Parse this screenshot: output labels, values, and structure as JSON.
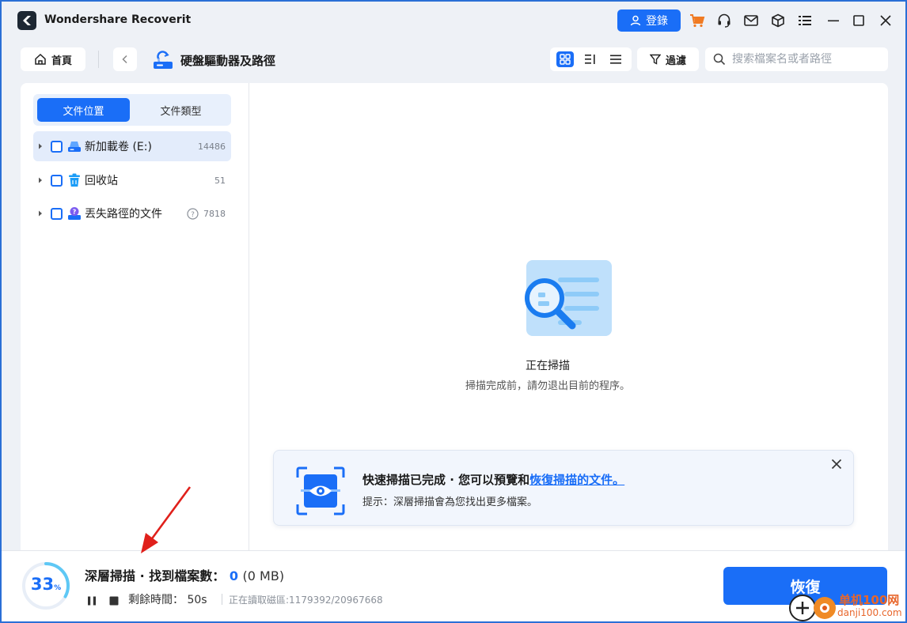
{
  "app": {
    "title": "Wondershare Recoverit",
    "login_label": "登錄"
  },
  "titlebar_icons": [
    "cart-icon",
    "headset-icon",
    "mail-icon",
    "cube-icon",
    "menu-icon",
    "minimize-icon",
    "maximize-icon",
    "close-icon"
  ],
  "toolbar": {
    "home_label": "首頁",
    "path_title": "硬盤驅動器及路徑",
    "filter_label": "過濾",
    "search_placeholder": "搜索檔案名或者路徑"
  },
  "sidebar": {
    "tabs": [
      {
        "label": "文件位置",
        "active": true
      },
      {
        "label": "文件類型",
        "active": false
      }
    ],
    "items": [
      {
        "label": "新加載卷 (E:)",
        "count": "14486",
        "icon": "drive-icon",
        "selected": true
      },
      {
        "label": "回收站",
        "count": "51",
        "icon": "recycle-bin-icon",
        "selected": false
      },
      {
        "label": "丟失路徑的文件",
        "count": "7818",
        "icon": "lost-path-icon",
        "selected": false
      }
    ]
  },
  "scan": {
    "title": "正在掃描",
    "subtitle": "掃描完成前，請勿退出目前的程序。"
  },
  "notice": {
    "title_prefix": "快速掃描已完成 · 您可以預覽和",
    "title_link": "恢復掃描的文件。",
    "hint": "提示：深層掃描會為您找出更多檔案。"
  },
  "status": {
    "progress_percent": 33,
    "percent_text": "33",
    "percent_symbol": "%",
    "deep_title": "深層掃描 · 找到檔案數：",
    "found_count": "0",
    "found_size": "(0 MB)",
    "remaining": "剩餘時間： 50s",
    "sector": "正在讀取磁區:1179392/20967668",
    "recover_label": "恢復"
  },
  "watermark": {
    "line1": "单机100网",
    "line2": "danji100.com"
  },
  "colors": {
    "accent": "#1a6ef7",
    "background": "#eef1f6",
    "annotation_arrow": "#e0201b"
  }
}
